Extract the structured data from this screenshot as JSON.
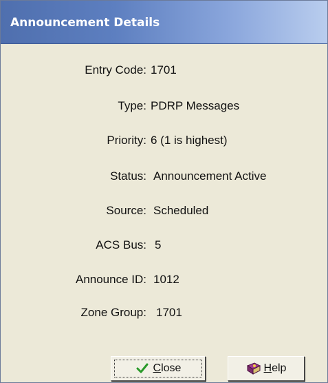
{
  "window": {
    "title": "Announcement Details"
  },
  "details": [
    {
      "label": "Entry Code:",
      "value": "1701"
    },
    {
      "label": "Type:",
      "value": "PDRP Messages"
    },
    {
      "label": "Priority:",
      "value": "6 (1 is highest)"
    },
    {
      "label": "Status:",
      "value": "Announcement Active"
    },
    {
      "label": "Source:",
      "value": "Scheduled"
    },
    {
      "label": "ACS Bus:",
      "value": "5"
    },
    {
      "label": "Announce ID:",
      "value": "1012"
    },
    {
      "label": "Zone Group:",
      "value": "1701"
    }
  ],
  "buttons": {
    "close": {
      "label_accel": "C",
      "label_rest": "lose",
      "icon": "checkmark-icon"
    },
    "help": {
      "label_accel": "H",
      "label_rest": "elp",
      "icon": "help-book-icon"
    }
  },
  "colors": {
    "titlebar_start": "#4f6fae",
    "titlebar_end": "#b9cdee",
    "window_bg": "#ece9d8",
    "checkmark": "#2a9a2a"
  }
}
